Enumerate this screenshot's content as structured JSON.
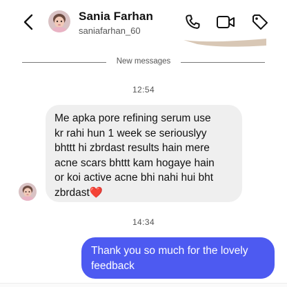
{
  "header": {
    "contact_name": "Sania Farhan",
    "contact_handle": "saniafarhan_60",
    "back_icon": "chevron-left-icon",
    "call_icon": "phone-icon",
    "video_icon": "video-camera-icon",
    "tag_icon": "tag-icon"
  },
  "conversation": {
    "separator_label": "New messages",
    "messages": [
      {
        "time": "12:54",
        "direction": "incoming",
        "lines": [
          "Me apka pore refining serum use",
          "kr rahi hun 1 week se seriouslyy",
          "bhttt hi zbrdast results hain mere",
          "acne scars bhttt kam hogaye hain",
          "or koi active acne bhi nahi hui bht"
        ],
        "last_line": "zbrdast",
        "emoji": "❤️"
      },
      {
        "time": "14:34",
        "direction": "outgoing",
        "lines": [
          "Thank you so much for the lovely",
          "feedback"
        ]
      }
    ]
  },
  "colors": {
    "outgoing_bubble": "#4d5af1",
    "incoming_bubble": "#efefef",
    "heart": "#e0243a"
  }
}
